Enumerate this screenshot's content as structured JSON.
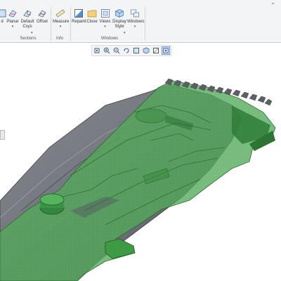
{
  "ribbon": {
    "buttons": [
      {
        "label": "d",
        "caret": false
      },
      {
        "label": "Planar",
        "caret": true
      },
      {
        "label": "Default",
        "label2": "Csys",
        "caret": true
      },
      {
        "label": "Offset",
        "caret": false
      },
      {
        "label": "Measure",
        "caret": true
      },
      {
        "label": "Repaint",
        "caret": false
      },
      {
        "label": "Close",
        "caret": false
      },
      {
        "label": "Views",
        "caret": true
      },
      {
        "label": "Display",
        "label2": "Style",
        "caret": true
      },
      {
        "label": "Windows",
        "caret": true
      }
    ],
    "groups": {
      "sections": "Sections",
      "info": "Info",
      "windows": "Windows"
    }
  },
  "view_toolbar": {
    "icons": [
      "refit-icon",
      "zoom-in-icon",
      "zoom-out-icon",
      "repaint-icon",
      "saved-views-icon",
      "display-style-icon",
      "datum-display-icon",
      "spin-center-icon"
    ],
    "active_index": 7
  },
  "colors": {
    "model_gray": "#6b6f75",
    "model_green": "#3e9a45",
    "ribbon_bg": "#f2f4f6"
  }
}
